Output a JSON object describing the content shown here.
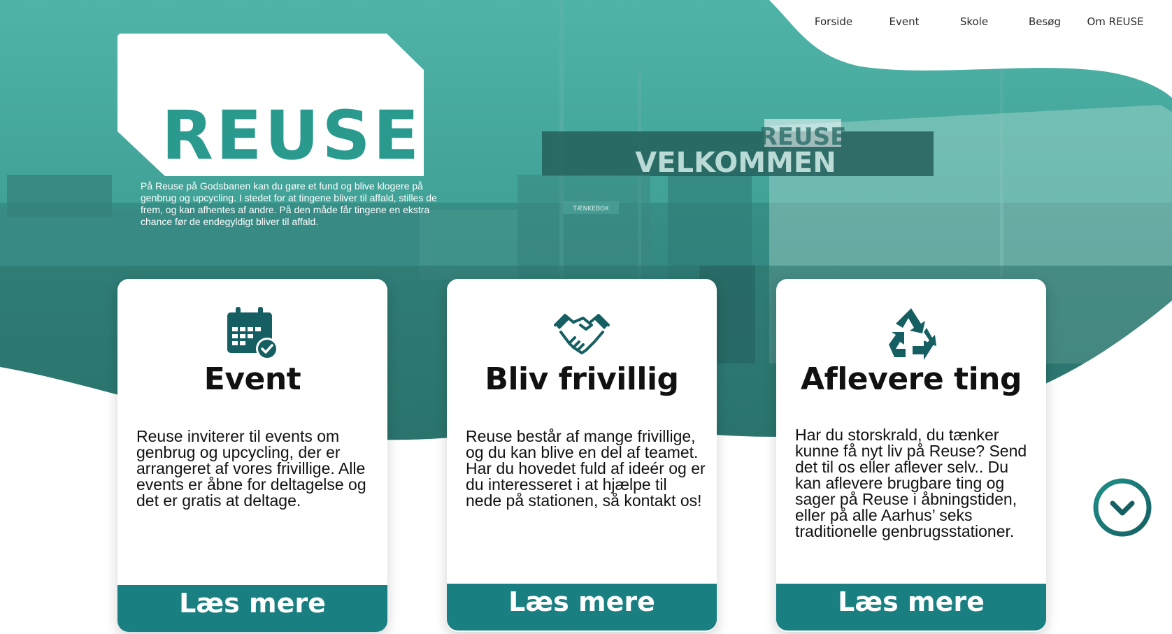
{
  "nav": {
    "items": [
      {
        "label": "Forside"
      },
      {
        "label": "Event"
      },
      {
        "label": "Skole"
      },
      {
        "label": "Besøg"
      },
      {
        "label": "Om REUSE"
      }
    ]
  },
  "hero": {
    "logo_text": "REUSE",
    "intro": "På Reuse på Godsbanen kan du gøre et fund og blive klogere på genbrug og upcycling. I stedet for at tingene bliver til affald, stilles de frem, og kan afhentes af andre. På den måde får tingene en ekstra chance før de endegyldigt bliver til affald.",
    "photo_signs": {
      "velkommen": "VELKOMMEN",
      "reuse": "REUSE",
      "taenkebox": "TÆNKEBOX"
    }
  },
  "cards": [
    {
      "icon": "calendar-check-icon",
      "title": "Event",
      "body": "Reuse inviterer til events om genbrug og upcycling, der er arrangeret af vores frivillige. Alle events er åbne for deltagelse og det er gratis at deltage.",
      "button": "Læs mere"
    },
    {
      "icon": "handshake-icon",
      "title": "Bliv frivillig",
      "body": "Reuse består af mange frivillige, og du kan blive en del af teamet. Har du hovedet fuld af ideér og er du interesseret i at hjælpe til nede på stationen, så kontakt os!",
      "button": "Læs mere"
    },
    {
      "icon": "recycle-icon",
      "title": "Aflevere ting",
      "body": "Har du storskrald, du tænker kunne få nyt liv på Reuse? Send det til os eller aflever selv.. Du kan aflevere brugbare ting og sager på Reuse i åbningstiden, eller på alle Aarhus’ seks traditionelle genbrugsstationer.",
      "button": "Læs mere"
    }
  ],
  "scroll": {
    "icon": "chevron-down-icon"
  },
  "colors": {
    "teal": "#2a9a8f",
    "button": "#1a7f81",
    "dark_teal": "#155f62"
  }
}
